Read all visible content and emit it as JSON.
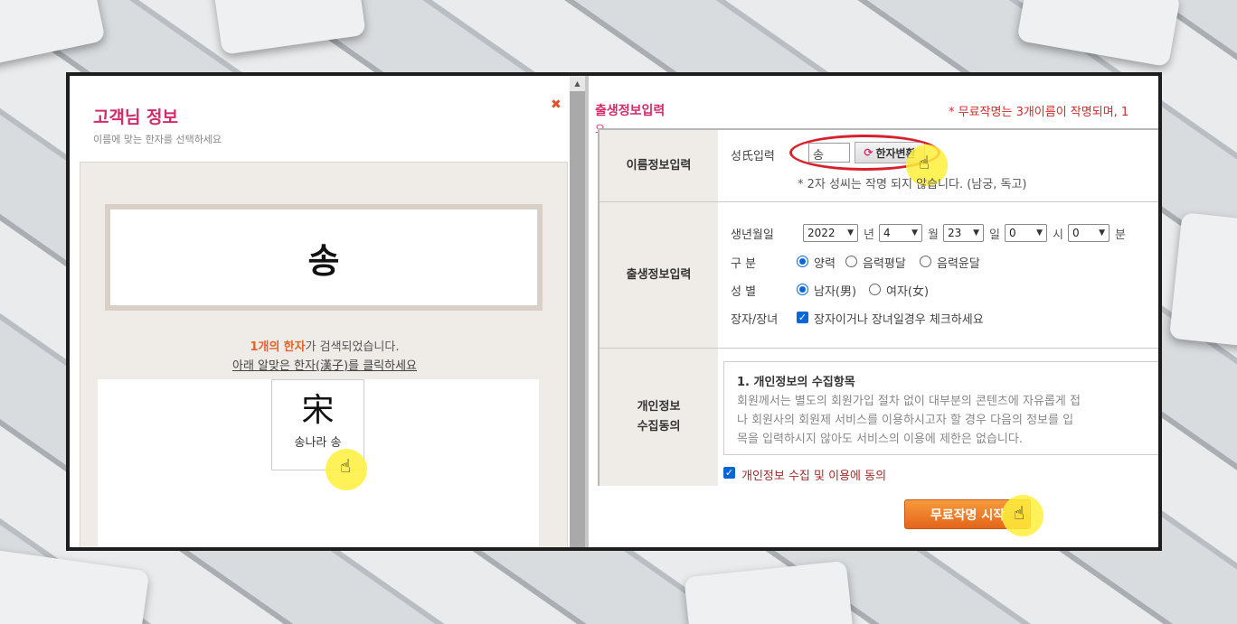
{
  "left": {
    "title": "고객님 정보",
    "subtitle": "이름에 맞는 한자를 선택하세요",
    "close": "✖",
    "surname": "송",
    "result_count": "1개의",
    "result_hanja": "한자",
    "result_rest": "가 검색되었습니다.",
    "click_instruction": "아래 알맞은 한자(漢子)를 클릭하세요",
    "hanja_card": {
      "char": "宋",
      "meaning": "송나라 송"
    },
    "scroll_up": "▲"
  },
  "right": {
    "title": "출생정보입력",
    "title_wrap": "요",
    "notice": "* 무료작명는 3개이름이 작명되며, 1",
    "name_section": {
      "label": "이름정보입력",
      "surname_label": "성氏입력",
      "surname_value": "송",
      "hanja_button": "한자변환",
      "hanja_button_icon": "⟳",
      "hint": "* 2자 성씨는 작명 되지 않습니다. (남궁, 독고)"
    },
    "birth_section": {
      "label": "출생정보입력",
      "birth_label": "생년월일",
      "year": "2022",
      "year_unit": "년",
      "month": "4",
      "month_unit": "월",
      "day": "23",
      "day_unit": "일",
      "hour": "0",
      "hour_unit": "시",
      "minute": "0",
      "minute_unit": "분",
      "calendar_label": "구 분",
      "calendar_options": [
        "양력",
        "음력평달",
        "음력윤달"
      ],
      "calendar_selected": 0,
      "gender_label": "성 별",
      "gender_options": [
        "남자(男)",
        "여자(女)"
      ],
      "gender_selected": 0,
      "eldest_label": "장자/장녀",
      "eldest_text": "장자이거나 장녀일경우 체크하세요",
      "eldest_checked": true
    },
    "privacy_section": {
      "label_line1": "개인정보",
      "label_line2": "수집동의",
      "heading": "1. 개인정보의 수집항목",
      "line1": "회원께서는 별도의 회원가입 절차 없이 대부분의 콘텐츠에 자유롭게 접",
      "line2": "나 회원사의 회원제 서비스를 이용하시고자 할 경우 다음의 정보를 입",
      "line3": "목을 입력하시지 않아도 서비스의 이용에 제한은 없습니다.",
      "agree_text": "개인정보 수집 및 이용에 동의",
      "agree_checked": true
    },
    "start_button": "무료작명 시작"
  },
  "cursor_icon": "hand-pointer",
  "colors": {
    "accent_pink": "#d12b6b",
    "accent_orange": "#e0642b",
    "highlight_yellow": "#fff03c",
    "annotation_red": "#d8202a",
    "checkbox_blue": "#0a66d6"
  }
}
